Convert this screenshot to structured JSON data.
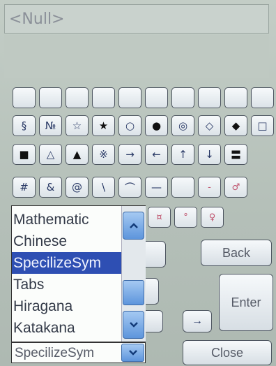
{
  "input": {
    "value": "<Null>"
  },
  "keyboard": {
    "row1": [
      "",
      "",
      "",
      "",
      "",
      "",
      "",
      "",
      "",
      ""
    ],
    "row2": [
      "§",
      "№",
      "☆",
      "★",
      "○",
      "●",
      "◎",
      "◇",
      "◆",
      "□"
    ],
    "row3": [
      "■",
      "△",
      "▲",
      "※",
      "→",
      "←",
      "↑",
      "↓",
      "〓"
    ],
    "row4": [
      "#",
      "&",
      "@",
      "\\",
      "⌒",
      "—",
      "",
      "-",
      "♂"
    ],
    "row5": [
      "¤",
      "°",
      "♀"
    ],
    "back_label": "Back",
    "enter_label": "Enter",
    "close_label": "Close",
    "right_arrow_label": "→"
  },
  "dropdown": {
    "items": [
      "Mathematic",
      "Chinese",
      "SpecilizeSym",
      "Tabs",
      "Hiragana",
      "Katakana"
    ],
    "selected_index": 2,
    "current_value": "SpecilizeSym"
  },
  "colors": {
    "selection": "#2e4fb3",
    "scroll_button": "#5d95dc",
    "key_glyph": "#2a3a66",
    "pink_glyph": "#c0546e"
  }
}
